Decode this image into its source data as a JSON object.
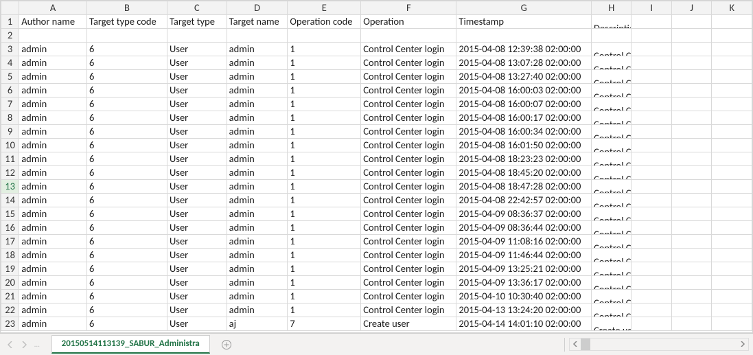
{
  "columns": [
    "A",
    "B",
    "C",
    "D",
    "E",
    "F",
    "G",
    "H",
    "I",
    "J",
    "K"
  ],
  "headers": {
    "A": "Author name",
    "B": "Target type code",
    "C": "Target type",
    "D": "Target name",
    "E": "Operation code",
    "F": "Operation",
    "G": "Timestamp",
    "H": "Description"
  },
  "selected_row": 13,
  "rows": [
    {
      "n": 1,
      "A": "Author name",
      "B": "Target type code",
      "C": "Target type",
      "D": "Target name",
      "E": "Operation code",
      "F": "Operation",
      "G": "Timestamp",
      "H": "Description",
      "is_header": true
    },
    {
      "n": 2
    },
    {
      "n": 3,
      "A": "admin",
      "B": 6,
      "C": "User",
      "D": "admin",
      "E": 1,
      "F": "Control Center login",
      "G": "2015-04-08 12:39:38 02:00:00",
      "H": "Control Center login of user \"admin\"."
    },
    {
      "n": 4,
      "A": "admin",
      "B": 6,
      "C": "User",
      "D": "admin",
      "E": 1,
      "F": "Control Center login",
      "G": "2015-04-08 13:07:28 02:00:00",
      "H": "Control Center login of user \"admin\"."
    },
    {
      "n": 5,
      "A": "admin",
      "B": 6,
      "C": "User",
      "D": "admin",
      "E": 1,
      "F": "Control Center login",
      "G": "2015-04-08 13:27:40 02:00:00",
      "H": "Control Center login of user \"admin\"."
    },
    {
      "n": 6,
      "A": "admin",
      "B": 6,
      "C": "User",
      "D": "admin",
      "E": 1,
      "F": "Control Center login",
      "G": "2015-04-08 16:00:03 02:00:00",
      "H": "Control Center login of user \"admin\"."
    },
    {
      "n": 7,
      "A": "admin",
      "B": 6,
      "C": "User",
      "D": "admin",
      "E": 1,
      "F": "Control Center login",
      "G": "2015-04-08 16:00:07 02:00:00",
      "H": "Control Center login of user \"admin\"."
    },
    {
      "n": 8,
      "A": "admin",
      "B": 6,
      "C": "User",
      "D": "admin",
      "E": 1,
      "F": "Control Center login",
      "G": "2015-04-08 16:00:17 02:00:00",
      "H": "Control Center login of user \"admin\"."
    },
    {
      "n": 9,
      "A": "admin",
      "B": 6,
      "C": "User",
      "D": "admin",
      "E": 1,
      "F": "Control Center login",
      "G": "2015-04-08 16:00:34 02:00:00",
      "H": "Control Center login of user \"admin\"."
    },
    {
      "n": 10,
      "A": "admin",
      "B": 6,
      "C": "User",
      "D": "admin",
      "E": 1,
      "F": "Control Center login",
      "G": "2015-04-08 16:01:50 02:00:00",
      "H": "Control Center login of user \"admin\"."
    },
    {
      "n": 11,
      "A": "admin",
      "B": 6,
      "C": "User",
      "D": "admin",
      "E": 1,
      "F": "Control Center login",
      "G": "2015-04-08 18:23:23 02:00:00",
      "H": "Control Center login of user \"admin\"."
    },
    {
      "n": 12,
      "A": "admin",
      "B": 6,
      "C": "User",
      "D": "admin",
      "E": 1,
      "F": "Control Center login",
      "G": "2015-04-08 18:45:20 02:00:00",
      "H": "Control Center login of user \"admin\"."
    },
    {
      "n": 13,
      "A": "admin",
      "B": 6,
      "C": "User",
      "D": "admin",
      "E": 1,
      "F": "Control Center login",
      "G": "2015-04-08 18:47:28 02:00:00",
      "H": "Control Center login of user \"admin\"."
    },
    {
      "n": 14,
      "A": "admin",
      "B": 6,
      "C": "User",
      "D": "admin",
      "E": 1,
      "F": "Control Center login",
      "G": "2015-04-08 22:42:57 02:00:00",
      "H": "Control Center login of user \"admin\"."
    },
    {
      "n": 15,
      "A": "admin",
      "B": 6,
      "C": "User",
      "D": "admin",
      "E": 1,
      "F": "Control Center login",
      "G": "2015-04-09 08:36:37 02:00:00",
      "H": "Control Center login of user \"admin\"."
    },
    {
      "n": 16,
      "A": "admin",
      "B": 6,
      "C": "User",
      "D": "admin",
      "E": 1,
      "F": "Control Center login",
      "G": "2015-04-09 08:36:44 02:00:00",
      "H": "Control Center login of user \"admin\"."
    },
    {
      "n": 17,
      "A": "admin",
      "B": 6,
      "C": "User",
      "D": "admin",
      "E": 1,
      "F": "Control Center login",
      "G": "2015-04-09 11:08:16 02:00:00",
      "H": "Control Center login of user \"admin\"."
    },
    {
      "n": 18,
      "A": "admin",
      "B": 6,
      "C": "User",
      "D": "admin",
      "E": 1,
      "F": "Control Center login",
      "G": "2015-04-09 11:46:44 02:00:00",
      "H": "Control Center login of user \"admin\"."
    },
    {
      "n": 19,
      "A": "admin",
      "B": 6,
      "C": "User",
      "D": "admin",
      "E": 1,
      "F": "Control Center login",
      "G": "2015-04-09 13:25:21 02:00:00",
      "H": "Control Center login of user \"admin\"."
    },
    {
      "n": 20,
      "A": "admin",
      "B": 6,
      "C": "User",
      "D": "admin",
      "E": 1,
      "F": "Control Center login",
      "G": "2015-04-09 13:36:17 02:00:00",
      "H": "Control Center login of user \"admin\"."
    },
    {
      "n": 21,
      "A": "admin",
      "B": 6,
      "C": "User",
      "D": "admin",
      "E": 1,
      "F": "Control Center login",
      "G": "2015-04-10 10:30:40 02:00:00",
      "H": "Control Center login of user \"admin\"."
    },
    {
      "n": 22,
      "A": "admin",
      "B": 6,
      "C": "User",
      "D": "admin",
      "E": 1,
      "F": "Control Center login",
      "G": "2015-04-13 13:24:20 02:00:00",
      "H": "Control Center login of user \"admin\"."
    },
    {
      "n": 23,
      "A": "admin",
      "B": 6,
      "C": "User",
      "D": "aj",
      "E": 7,
      "F": "Create user",
      "G": "2015-04-14 14:01:10 02:00:00",
      "H": "Create user \"aj\" in folder \"BIURO\"."
    }
  ],
  "tab_label": "20150514113139_SABUR_Administra"
}
